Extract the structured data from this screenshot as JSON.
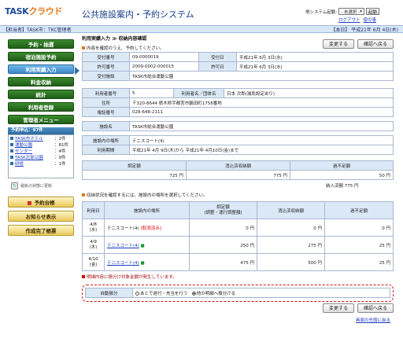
{
  "header": {
    "logo_text": "TASK",
    "logo_cloud": "クラウド",
    "app_title": "公共施設案内・予約システム",
    "system_start_label": "他システム起動:",
    "system_select_value": "- 未選択 -",
    "start_button": "起動",
    "logout": "ログアウト",
    "help": "使の事"
  },
  "bar": {
    "left": "【担当者】TASK市：TKC管理者",
    "right": "【本日】 平成21年 6月 4日(木)"
  },
  "sidebar": {
    "menu": [
      "予約・抽選",
      "宿泊施設予約",
      "利用実績入力",
      "料金収納",
      "統計",
      "利用者登録",
      "管理者メニュー"
    ],
    "reservation_header": "予約申込：97件",
    "reservations": [
      {
        "name": "TASK市ホテル",
        "count": "：2件"
      },
      {
        "name": "運動公園",
        "count": "：81件"
      },
      {
        "name": "センター",
        "count": "：4件"
      },
      {
        "name": "TASK北部公園",
        "count": "：9件"
      },
      {
        "name": "研修",
        "count": "：1件"
      }
    ],
    "refresh_text": "最新の状態に更新",
    "buttons": [
      "予約台帳",
      "お知らせ表示",
      "作成完了帳票"
    ]
  },
  "main": {
    "breadcrumb": "利用実績入力 ≫ 収納内容確認",
    "change_button": "変更する",
    "confirm_button": "確認へ戻る",
    "note1": "内容を確認のうえ、予約してください。",
    "info": {
      "uketsuke_no_label": "受付番号",
      "uketsuke_no": "09-0000019",
      "uketsuke_date_label": "受付日",
      "uketsuke_date": "平成21年 6月 3日(水)",
      "kyoka_no_label": "許可番号",
      "kyoka_no": "2009-0002-000015",
      "kyoka_date_label": "許可日",
      "kyoka_date": "平成21年 6月 3日(水)",
      "facility_label": "受付施設",
      "facility": "TASK市総合運動公園"
    },
    "user": {
      "user_no_label": "利用者番号",
      "user_no": "5",
      "user_name_label": "利用者名／団体名",
      "user_name": "日本 次郎(減免設定あり)",
      "address_label": "住所",
      "address": "〒320-8644 栃木県宇都宮市鶴田町1758番地",
      "tel_label": "電話番号",
      "tel": "028-648-2111"
    },
    "place": {
      "facility_label": "施設名",
      "facility": "TASK市総合運動公園",
      "place_label": "施設内の場所",
      "place": "テニスコート(4)",
      "period_label": "利用期間",
      "period": "平成21年 4月 9日(木)から 平成21年 4月10日(金)まで"
    },
    "summary": {
      "headers": [
        "調定額",
        "消込済収納額",
        "過不足額"
      ],
      "values": [
        "725 円",
        "775 円",
        "50 円"
      ],
      "note": "納入済額 775 円"
    },
    "note2": "収納状況を確認するには、施設内の場所を選択してください。",
    "table": {
      "headers": [
        "利用日",
        "施設内の場所",
        "調定額\n(調整・運行調整額)",
        "消込済収納額",
        "過不足額"
      ],
      "rows": [
        {
          "date": "4/8",
          "dow": "(水)",
          "place": "テニスコート(4)",
          "tag": "[取消済み]",
          "amount": "0 円",
          "paid": "0 円",
          "diff": "0 円",
          "link": false
        },
        {
          "date": "4/9",
          "dow": "(木)",
          "place": "テニスコート(4)",
          "tag": "■",
          "amount": "250 円",
          "paid": "275 円",
          "diff": "25 円",
          "link": true
        },
        {
          "date": "4/10",
          "dow": "(金)",
          "place": "テニスコート(4)",
          "tag": "■",
          "amount": "475 円",
          "paid": "500 円",
          "diff": "25 円",
          "link": true
        }
      ]
    },
    "warning": "明細内容に振分け対象金額が発生しています。",
    "auto": {
      "label": "自動振分",
      "opt1": "あとで遅付・充当を行う",
      "opt2": "他の明細へ振分ける"
    },
    "page_top": "画面の先頭に戻る"
  }
}
